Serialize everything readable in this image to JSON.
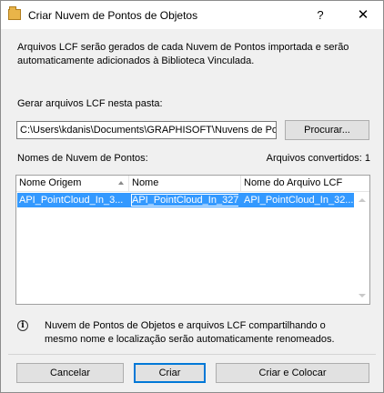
{
  "window": {
    "title": "Criar Nuvem de Pontos de Objetos",
    "help_label": "?",
    "close_label": "✕"
  },
  "info": {
    "line1": "Arquivos LCF serão gerados de cada Nuvem de Pontos importada e serão",
    "line2": "automaticamente adicionados à Biblioteca Vinculada."
  },
  "folder": {
    "label": "Gerar arquivos LCF nesta pasta:",
    "path": "C:\\Users\\kdanis\\Documents\\GRAPHISOFT\\Nuvens de Po",
    "browse_label": "Procurar..."
  },
  "list": {
    "label": "Nomes de Nuvem de Pontos:",
    "converted": "Arquivos convertidos: 1",
    "columns": [
      "Nome Origem",
      "Nome",
      "Nome do Arquivo LCF"
    ],
    "rows": [
      {
        "origin": "API_PointCloud_In_3...",
        "name": "API_PointCloud_In_327",
        "lcf": "API_PointCloud_In_32..."
      }
    ]
  },
  "note": {
    "line1": "Nuvem de Pontos de Objetos e arquivos LCF compartilhando o",
    "line2": "mesmo nome e localização serão automaticamente renomeados."
  },
  "buttons": {
    "cancel": "Cancelar",
    "create": "Criar",
    "create_place": "Criar e Colocar"
  }
}
